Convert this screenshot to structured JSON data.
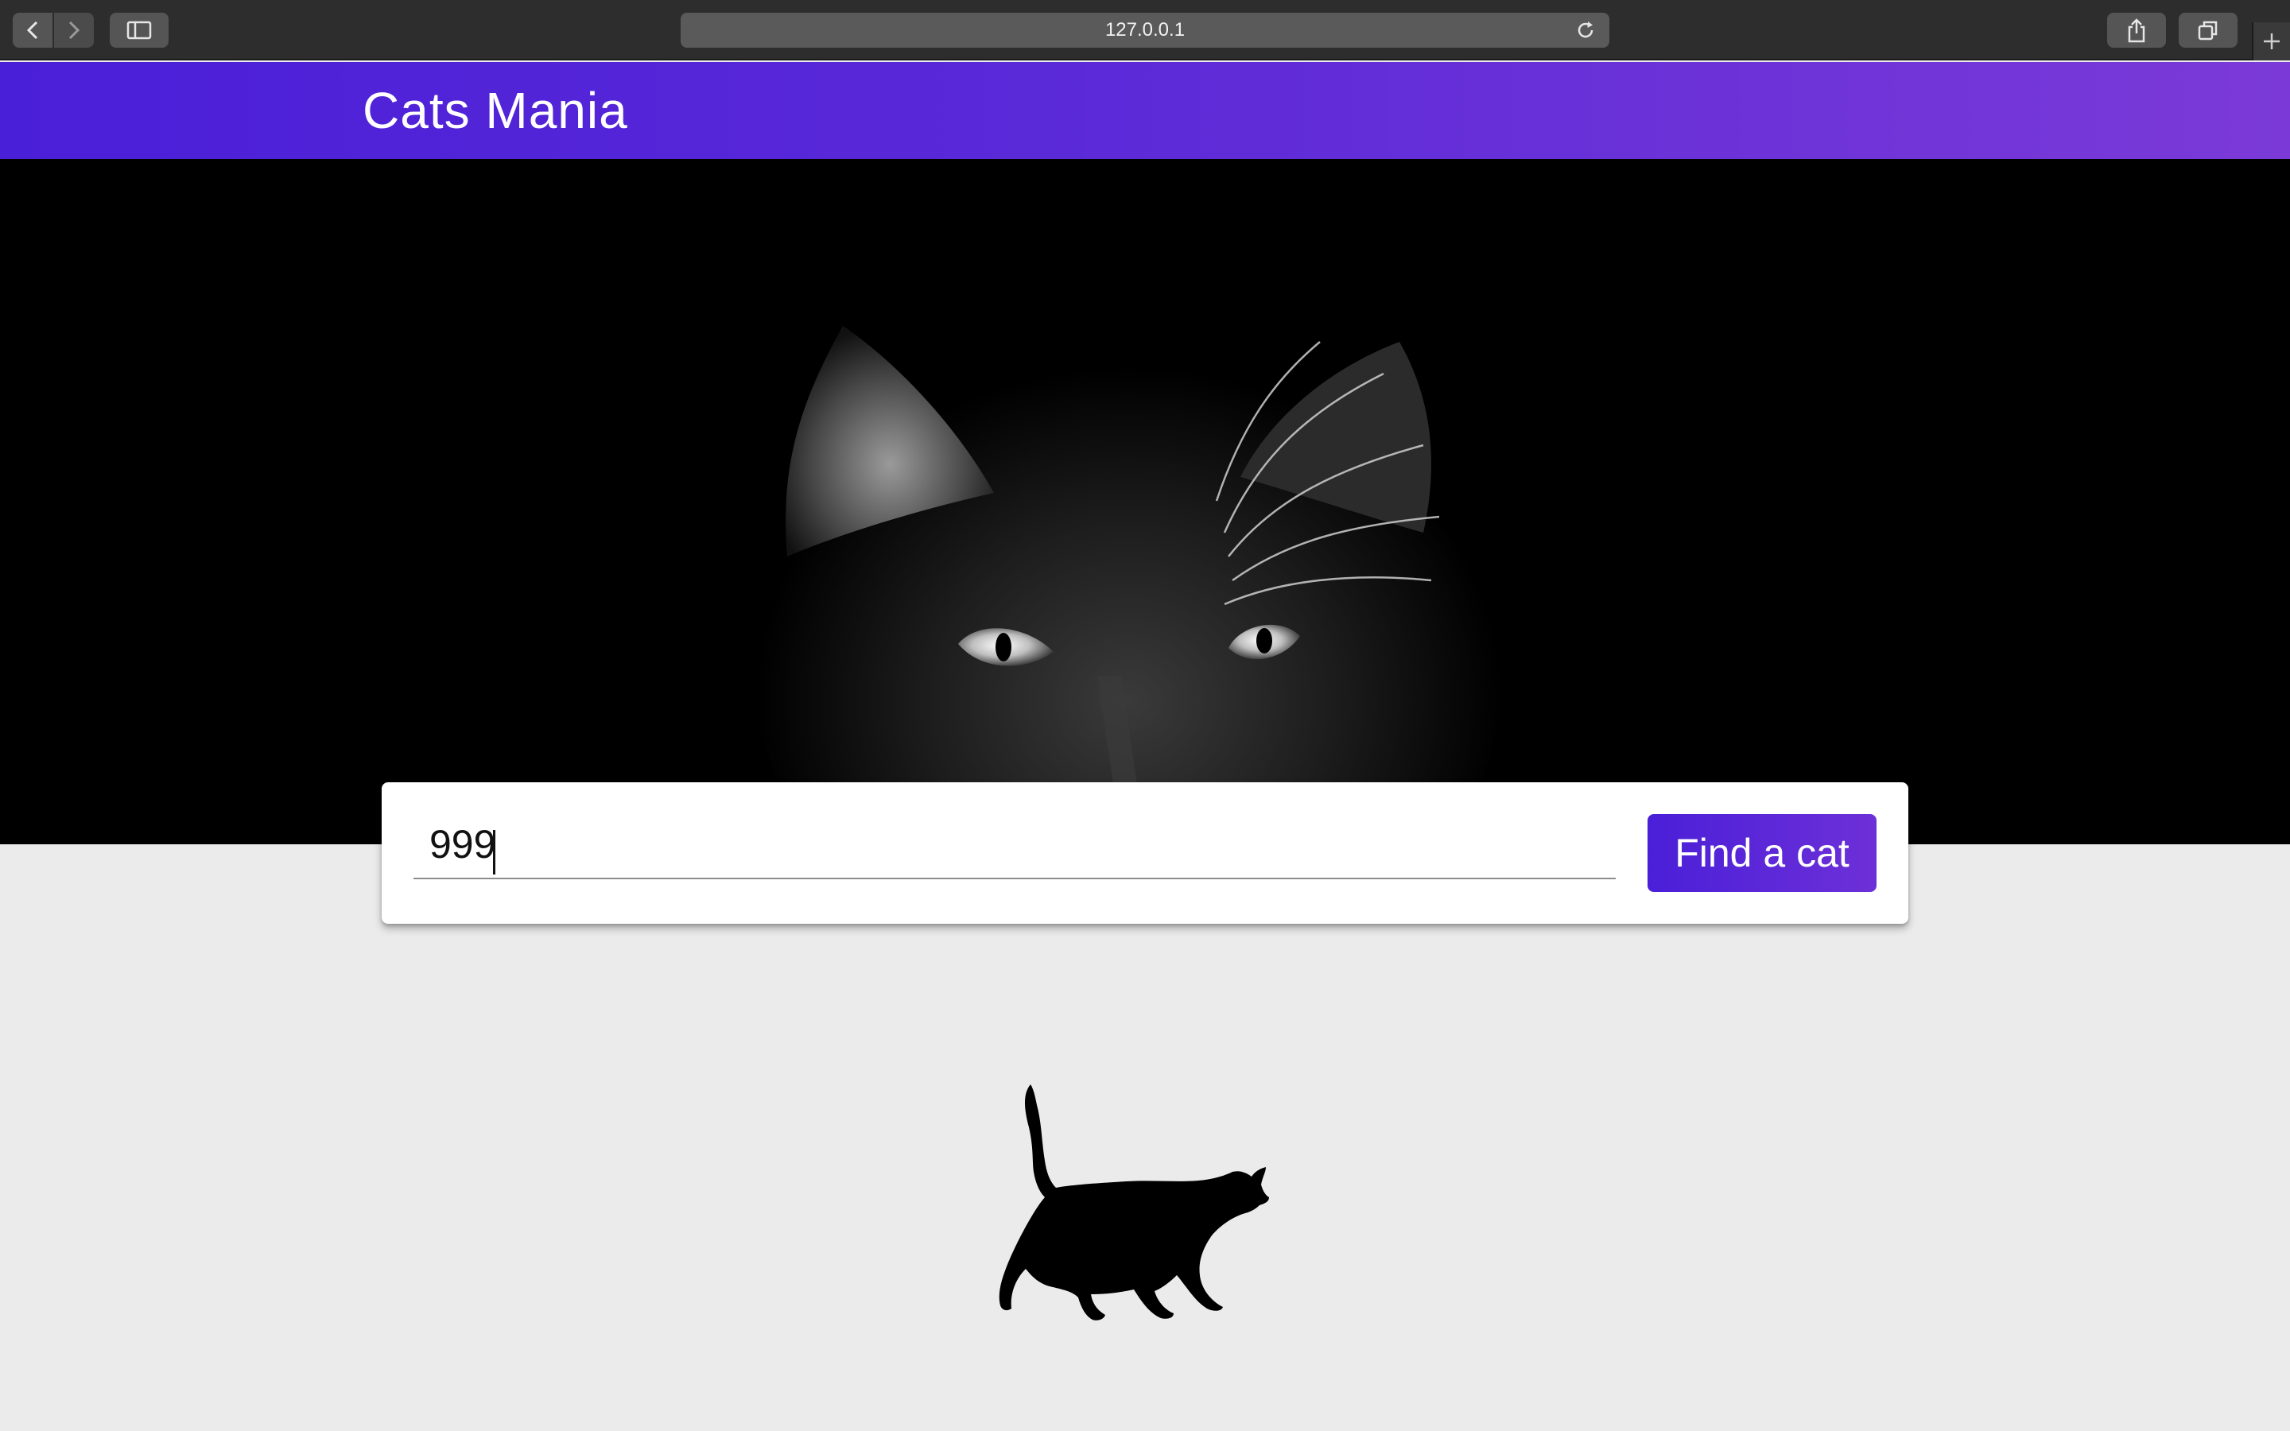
{
  "browser": {
    "url": "127.0.0.1",
    "icons": [
      "back-icon",
      "forward-icon",
      "sidebar-icon",
      "reload-icon",
      "share-icon",
      "tabs-icon",
      "new-tab-icon"
    ]
  },
  "header": {
    "title": "Cats Mania"
  },
  "search": {
    "value": "999",
    "button_label": "Find a cat"
  },
  "colors": {
    "brand_gradient_start": "#4a1fd8",
    "brand_gradient_end": "#7b3ad8",
    "page_background": "#ebebeb"
  }
}
